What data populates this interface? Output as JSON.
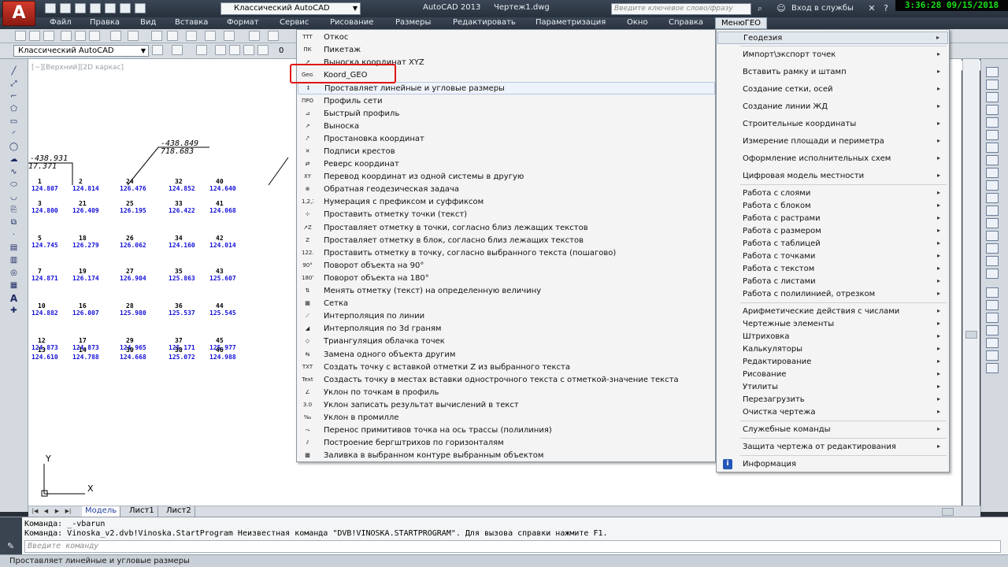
{
  "titlebar": {
    "app_logo_letter": "A",
    "workspace": "Классический AutoCAD",
    "app_name": "AutoCAD 2013",
    "document": "Чертеж1.dwg",
    "search_placeholder": "Введите ключевое слово/фразу",
    "login": "Вход в службы",
    "clock": "3:36:28 09/15/2018"
  },
  "menubar": [
    "Файл",
    "Правка",
    "Вид",
    "Вставка",
    "Формат",
    "Сервис",
    "Рисование",
    "Размеры",
    "Редактировать",
    "Параметризация",
    "Окно",
    "Справка",
    "МенюГЕО"
  ],
  "toolbar": {
    "workspace_combo": "Классический AutoCAD",
    "layer_value": "0"
  },
  "drawing": {
    "viewport_label": "[−][Верхний][2D каркас]",
    "annotations": [
      "-438.931",
      "17.371",
      "-438.849",
      "718.683"
    ],
    "points": [
      {
        "num": "1",
        "label": "124.807"
      },
      {
        "num": "2",
        "label": "124.814"
      },
      {
        "num": "24",
        "label": "126.476"
      },
      {
        "num": "32",
        "label": "124.852"
      },
      {
        "num": "40",
        "label": "124.640"
      },
      {
        "num": "3",
        "label": "124.800"
      },
      {
        "num": "21",
        "label": "126.409"
      },
      {
        "num": "25",
        "label": "126.195"
      },
      {
        "num": "33",
        "label": "126.422"
      },
      {
        "num": "41",
        "label": "124.068"
      },
      {
        "num": "5",
        "label": "124.745"
      },
      {
        "num": "18",
        "label": "126.279"
      },
      {
        "num": "26",
        "label": "126.062"
      },
      {
        "num": "34",
        "label": "124.160"
      },
      {
        "num": "42",
        "label": "124.014"
      },
      {
        "num": "7",
        "label": "124.871"
      },
      {
        "num": "19",
        "label": "126.174"
      },
      {
        "num": "27",
        "label": "126.904"
      },
      {
        "num": "35",
        "label": "125.863"
      },
      {
        "num": "43",
        "label": "125.607"
      },
      {
        "num": "10",
        "label": "124.882"
      },
      {
        "num": "16",
        "label": "126.007"
      },
      {
        "num": "28",
        "label": "125.980"
      },
      {
        "num": "36",
        "label": "125.537"
      },
      {
        "num": "44",
        "label": "125.545"
      },
      {
        "num": "12",
        "label": "124.873"
      },
      {
        "num": "17",
        "label": "124.873"
      },
      {
        "num": "29",
        "label": "124.965"
      },
      {
        "num": "37",
        "label": "125.171"
      },
      {
        "num": "45",
        "label": "125.977"
      },
      {
        "num": "13",
        "label": "124.610"
      },
      {
        "num": "14",
        "label": "124.788"
      },
      {
        "num": "30",
        "label": "124.668"
      },
      {
        "num": "38",
        "label": "125.072"
      },
      {
        "num": "46",
        "label": "124.988"
      }
    ],
    "ucs_y": "Y",
    "ucs_x": "X"
  },
  "tabs": [
    "Модель",
    "Лист1",
    "Лист2"
  ],
  "command": {
    "line1": "Команда: _-vbarun",
    "line2": "Команда: Vinoska_v2.dvb!Vinoska.StartProgram Неизвестная команда \"DVB!VINOSKA.STARTPROGRAM\".  Для вызова справки нажмите F1.",
    "input_placeholder": "Введите команду"
  },
  "statusbar": {
    "text": "Проставляет линейные и угловые размеры"
  },
  "submenu": {
    "items": [
      {
        "icon": "TTT",
        "label": "Откос"
      },
      {
        "icon": "ПК",
        "label": "Пикетаж"
      },
      {
        "icon": "↗",
        "label": "Выноска координат XYZ"
      },
      {
        "icon": "GeoXY",
        "label": "Koord_GEO"
      },
      {
        "icon": "↕",
        "label": "Проставляет линейные и угловые размеры"
      },
      {
        "icon": "ПРО",
        "label": "Профиль сети"
      },
      {
        "icon": "⊿",
        "label": "Быстрый профиль"
      },
      {
        "icon": "↗",
        "label": "Выноска"
      },
      {
        "icon": "⤤",
        "label": "Простановка координат"
      },
      {
        "icon": "✕",
        "label": "Подписи крестов"
      },
      {
        "icon": "⇄",
        "label": "Реверс координат"
      },
      {
        "icon": "XY",
        "label": "Перевод координат из одной системы в другую"
      },
      {
        "icon": "⊕",
        "label": "Обратная геодезическая задача"
      },
      {
        "icon": "1,2,3",
        "label": "Нумерация с префиксом и суффиксом"
      },
      {
        "icon": "⊹",
        "label": "Проставить отметку точки (текст)"
      },
      {
        "icon": "↗Z",
        "label": "Проставляет отметку в точки, согласно близ лежащих текстов"
      },
      {
        "icon": "Z",
        "label": "Проставляет отметку в блок, согласно близ лежащих текстов"
      },
      {
        "icon": "122.5",
        "label": "Проставить отметку в точку, согласно выбранного текста (пошагово)"
      },
      {
        "icon": "90°",
        "label": "Поворот объекта на 90°"
      },
      {
        "icon": "180°",
        "label": "Поворот объекта на 180°"
      },
      {
        "icon": "⇅",
        "label": "Менять отметку (текст) на определенную величину"
      },
      {
        "icon": "▦",
        "label": "Сетка"
      },
      {
        "icon": "⟋",
        "label": "Интерполяция по линии"
      },
      {
        "icon": "◢",
        "label": "Интерполяция по 3d граням"
      },
      {
        "icon": "◇",
        "label": "Триангуляция облачка точек"
      },
      {
        "icon": "⇆",
        "label": "Замена одного объекта другим"
      },
      {
        "icon": "TXT",
        "label": "Создать точку с вставкой отметки Z из выбранного текста"
      },
      {
        "icon": "Text",
        "label": "Создасть точку в местах вставки однострочного текста с отметкой-значение текста"
      },
      {
        "icon": "∠",
        "label": "Уклон по точкам в профиль"
      },
      {
        "icon": "3.0",
        "label": "Уклон записать результат вычислений в текст"
      },
      {
        "icon": "‰",
        "label": "Уклон в промилле"
      },
      {
        "icon": "⤳",
        "label": "Перенос примитивов точка на ось трассы (полилиния)"
      },
      {
        "icon": "⫽",
        "label": "Построение бергштрихов по горизонталям"
      },
      {
        "icon": "▩",
        "label": "Заливка в выбранном контуре выбранным объектом"
      }
    ]
  },
  "mainmenu": {
    "items": [
      {
        "label": "Геодезия",
        "arrow": "▸"
      },
      {
        "label": "Импорт\\экспорт точек",
        "arrow": "▸"
      },
      {
        "label": "Вставить рамку и штамп",
        "arrow": "▸"
      },
      {
        "label": "Создание сетки, осей",
        "arrow": "▸"
      },
      {
        "label": "Создание линии ЖД",
        "arrow": "▸"
      },
      {
        "label": "Строительные координаты",
        "arrow": "▸"
      },
      {
        "label": "Измерение площади и периметра",
        "arrow": "▸"
      },
      {
        "label": "Оформление исполнительных схем",
        "arrow": "▸"
      },
      {
        "label": "Цифровая модель местности",
        "arrow": "▸"
      },
      {
        "label": "Работа с слоями",
        "arrow": "▸"
      },
      {
        "label": "Работа с блоком",
        "arrow": "▸"
      },
      {
        "label": "Работа с растрами",
        "arrow": "▸"
      },
      {
        "label": "Работа с размером",
        "arrow": "▸"
      },
      {
        "label": "Работа с таблицей",
        "arrow": "▸"
      },
      {
        "label": "Работа с точками",
        "arrow": "▸"
      },
      {
        "label": "Работа с текстом",
        "arrow": "▸"
      },
      {
        "label": "Работа с листами",
        "arrow": "▸"
      },
      {
        "label": "Работа с полилинией, отрезком",
        "arrow": "▸"
      },
      {
        "label": "Арифметические действия с числами",
        "arrow": "▸"
      },
      {
        "label": "Чертежные элементы",
        "arrow": "▸"
      },
      {
        "label": "Штриховка",
        "arrow": "▸"
      },
      {
        "label": "Калькуляторы",
        "arrow": "▸"
      },
      {
        "label": "Редактирование",
        "arrow": "▸"
      },
      {
        "label": "Рисование",
        "arrow": "▸"
      },
      {
        "label": "Утилиты",
        "arrow": "▸"
      },
      {
        "label": "Перезагрузить",
        "arrow": "▸"
      },
      {
        "label": "Очистка чертежа",
        "arrow": "▸"
      },
      {
        "label": "Служебные команды",
        "arrow": "▸"
      },
      {
        "label": "Защита чертежа от редактирования",
        "arrow": "▸"
      },
      {
        "label": "Информация",
        "arrow": ""
      }
    ],
    "info_icon": "i"
  },
  "colors": {
    "elevation_text": "#1410d8",
    "highlight_box": "#e01515",
    "clock_text": "#19e019"
  }
}
